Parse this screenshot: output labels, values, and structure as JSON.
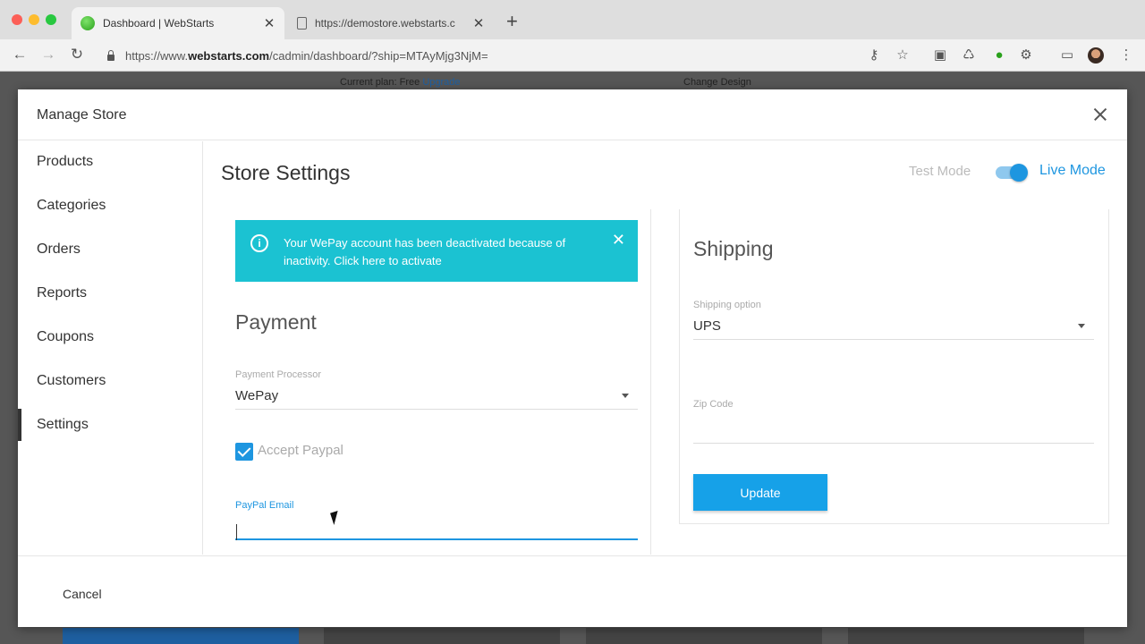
{
  "browser": {
    "tabs": [
      {
        "title": "Dashboard | WebStarts",
        "active": true
      },
      {
        "title": "https://demostore.webstarts.c",
        "active": false
      }
    ],
    "url": {
      "prefix": "https://www.",
      "domain": "webstarts.com",
      "path": "/cadmin/dashboard/?ship=MTAyMjg3NjM="
    }
  },
  "background": {
    "plan_text": "Current plan: Free",
    "upgrade": "Upgrade",
    "change_design": "Change Design"
  },
  "modal": {
    "title": "Manage Store",
    "sidebar": [
      {
        "label": "Products"
      },
      {
        "label": "Categories"
      },
      {
        "label": "Orders"
      },
      {
        "label": "Reports"
      },
      {
        "label": "Coupons"
      },
      {
        "label": "Customers"
      },
      {
        "label": "Settings",
        "active": true
      }
    ],
    "content": {
      "title": "Store Settings",
      "test_mode": "Test Mode",
      "live_mode": "Live Mode",
      "alert": {
        "icon": "i",
        "text": "Your WePay account has been deactivated because of inactivity. Click here to activate",
        "close": "✕"
      },
      "payment": {
        "title": "Payment",
        "processor_label": "Payment Processor",
        "processor_value": "WePay",
        "accept_paypal": "Accept Paypal",
        "paypal_email_label": "PayPal Email",
        "paypal_email_value": ""
      },
      "shipping": {
        "title": "Shipping",
        "option_label": "Shipping option",
        "option_value": "UPS",
        "zip_label": "Zip Code",
        "zip_value": "",
        "update_button": "Update"
      }
    },
    "footer": {
      "cancel": "Cancel"
    }
  },
  "colors": {
    "accent": "#1e96e0",
    "alert_bg": "#1bc2d2",
    "button": "#16a1e8"
  }
}
